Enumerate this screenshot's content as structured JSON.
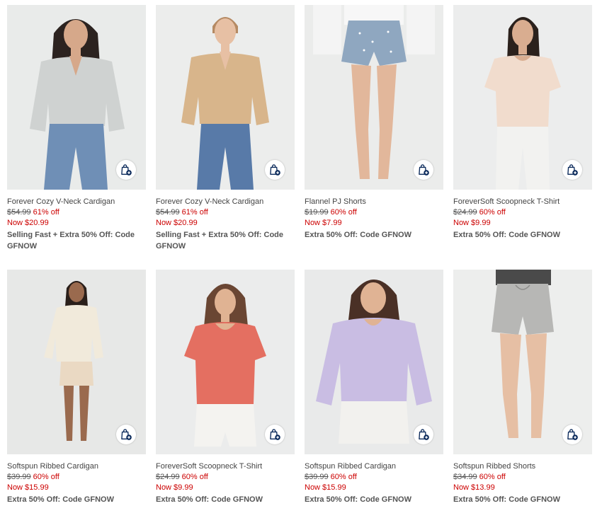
{
  "colors": {
    "sale": "#cc0000",
    "text": "#444444",
    "icon_navy": "#0b2a5b"
  },
  "products": [
    {
      "name": "Forever Cozy V-Neck Cardigan",
      "original_price": "$54.99",
      "discount": "61% off",
      "now_price": "Now $20.99",
      "promo": "Selling Fast + Extra 50% Off: Code GFNOW",
      "icon": "bag-plus-icon"
    },
    {
      "name": "Forever Cozy V-Neck Cardigan",
      "original_price": "$54.99",
      "discount": "61% off",
      "now_price": "Now $20.99",
      "promo": "Selling Fast + Extra 50% Off: Code GFNOW",
      "icon": "bag-plus-icon"
    },
    {
      "name": "Flannel PJ Shorts",
      "original_price": "$19.99",
      "discount": "60% off",
      "now_price": "Now $7.99",
      "promo": "Extra 50% Off: Code GFNOW",
      "icon": "bag-plus-icon"
    },
    {
      "name": "ForeverSoft Scoopneck T-Shirt",
      "original_price": "$24.99",
      "discount": "60% off",
      "now_price": "Now $9.99",
      "promo": "Extra 50% Off: Code GFNOW",
      "icon": "bag-plus-icon"
    },
    {
      "name": "Softspun Ribbed Cardigan",
      "original_price": "$39.99",
      "discount": "60% off",
      "now_price": "Now $15.99",
      "promo": "Extra 50% Off: Code GFNOW",
      "icon": "bag-plus-icon"
    },
    {
      "name": "ForeverSoft Scoopneck T-Shirt",
      "original_price": "$24.99",
      "discount": "60% off",
      "now_price": "Now $9.99",
      "promo": "Extra 50% Off: Code GFNOW",
      "icon": "bag-plus-icon"
    },
    {
      "name": "Softspun Ribbed Cardigan",
      "original_price": "$39.99",
      "discount": "60% off",
      "now_price": "Now $15.99",
      "promo": "Extra 50% Off: Code GFNOW",
      "icon": "bag-plus-icon"
    },
    {
      "name": "Softspun Ribbed Shorts",
      "original_price": "$34.99",
      "discount": "60% off",
      "now_price": "Now $13.99",
      "promo": "Extra 50% Off: Code GFNOW",
      "icon": "bag-plus-icon"
    }
  ]
}
